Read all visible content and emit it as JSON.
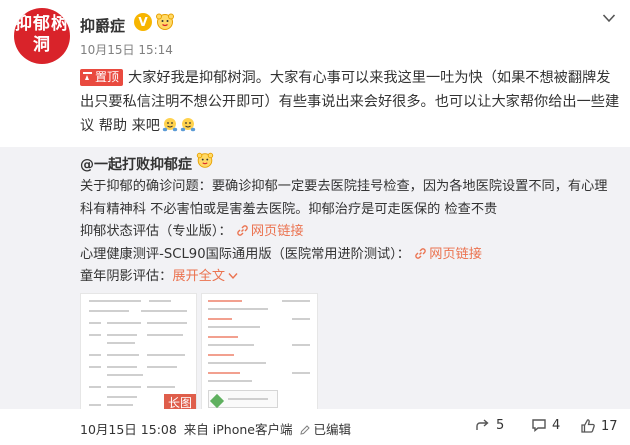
{
  "post": {
    "avatar_text": "抑郁树洞",
    "username": "抑爵症",
    "timestamp": "10月15日 15:14",
    "pin_label": "置顶",
    "body": "大家好我是抑郁树洞。大家有心事可以来我这里一吐为快（如果不想被翻牌发出只要私信注明不想公开即可）有些事说出来会好很多。也可以让大家帮你给出一些建议  帮助  来吧",
    "emoji_names": [
      "hug-emoji",
      "hug-emoji"
    ]
  },
  "repost": {
    "user": "@一起打败抑郁症",
    "line_1": "关于抑郁的确诊问题：要确诊抑郁一定要去医院挂号检查，因为各地医院设置不同，有心理科有精神科 不必害怕或是害羞去医院。抑郁治疗是可走医保的 检查不贵",
    "line_2_prefix": "抑郁状态评估（专业版）：",
    "line_2_link": "网页链接",
    "line_3_prefix": "心理健康测评-SCL90国际通用版（医院常用进阶测试）：",
    "line_3_link": "网页链接",
    "line_4_prefix": "童年阴影评估：",
    "line_4_link": "展开全文",
    "long_image_label": "长图"
  },
  "footer": {
    "date": "10月15日 15:08",
    "source": "来自 iPhone客户端",
    "edited": "已编辑",
    "share_count": "5",
    "comment_count": "4",
    "like_count": "17"
  },
  "colors": {
    "accent": "#eb7350",
    "pin": "#e94a3f",
    "avatar": "#d9232a",
    "repost_bg": "#f2f2f5"
  }
}
